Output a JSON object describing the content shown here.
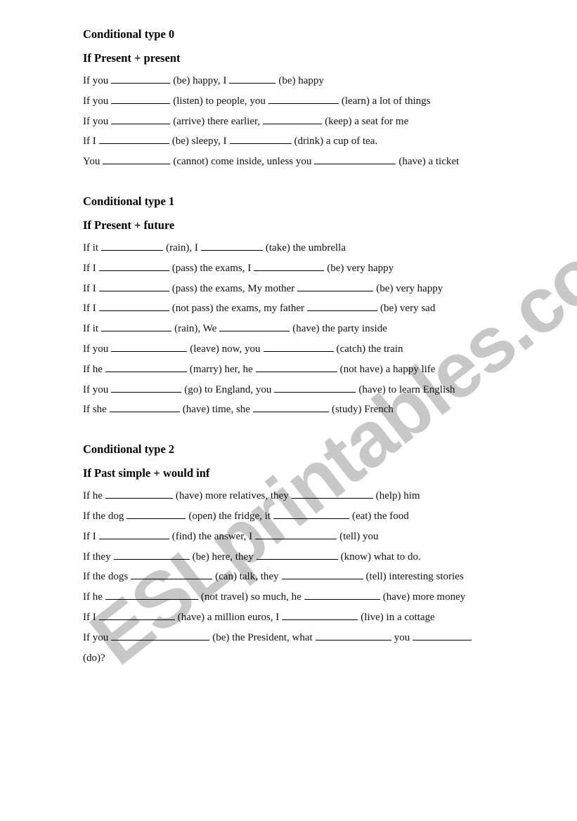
{
  "watermark": "ESLprintables.com",
  "sections": [
    {
      "title": "Conditional type 0",
      "subtitle": "If  Present + present",
      "lines": [
        [
          "If you",
          "(be) happy, I",
          "(be) happy"
        ],
        [
          "If you",
          "(listen) to people, you",
          "(learn) a lot of things"
        ],
        [
          "If you",
          "(arrive) there earlier,",
          "(keep) a seat for me"
        ],
        [
          "If I",
          "(be) sleepy, I",
          "(drink) a cup of tea."
        ],
        [
          "You",
          "(cannot) come inside, unless you",
          "(have) a ticket"
        ]
      ]
    },
    {
      "title": "Conditional type 1",
      "subtitle": "If  Present + future",
      "lines": [
        [
          "If it",
          "(rain), I",
          "(take) the umbrella"
        ],
        [
          "If I",
          "(pass) the exams, I",
          "(be) very happy"
        ],
        [
          "If I",
          "(pass) the exams, My mother",
          "(be) very happy"
        ],
        [
          "If I",
          "(not pass) the exams, my father",
          "(be) very sad"
        ],
        [
          "If it",
          "(rain), We",
          "(have) the party inside"
        ],
        [
          "If you",
          "(leave) now, you",
          "(catch) the train"
        ],
        [
          "If he",
          "(marry) her, he",
          "(not have) a happy life"
        ],
        [
          "If you",
          "(go) to England, you",
          "(have) to learn English"
        ],
        [
          "If she",
          "(have) time, she",
          "(study) French"
        ]
      ]
    },
    {
      "title": "Conditional type 2",
      "subtitle": "If Past simple + would inf",
      "lines": [
        [
          "If he",
          "(have) more relatives, they",
          "(help) him"
        ],
        [
          "If the dog",
          "(open) the fridge, it",
          "(eat) the food"
        ],
        [
          "If I",
          "(find) the answer, I",
          "(tell) you"
        ],
        [
          "If they",
          "(be) here, they",
          "(know) what to do."
        ],
        [
          "If the dogs",
          "(can) talk, they",
          "(tell) interesting stories"
        ],
        [
          "If he",
          "(not travel) so much, he",
          "(have) more money"
        ],
        [
          "If I",
          "(have) a million euros, I",
          "(live) in a cottage"
        ]
      ],
      "last_line": [
        "If you",
        "(be) the President, what",
        "you",
        ""
      ],
      "last_line_wrap": "(do)?"
    }
  ]
}
